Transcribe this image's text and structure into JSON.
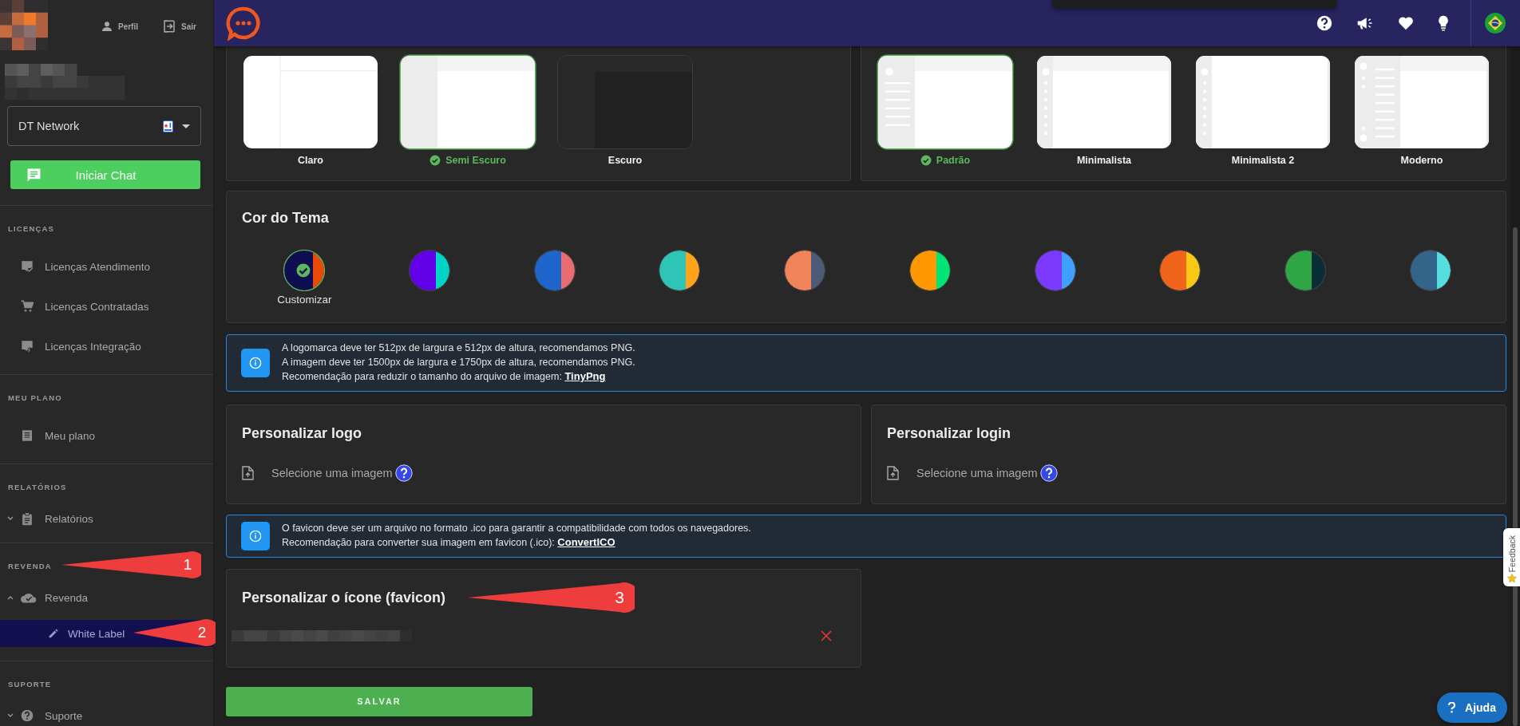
{
  "sidebar": {
    "profile_links": [
      {
        "label": "Perfil"
      },
      {
        "label": "Sair"
      }
    ],
    "workspace": "DT Network",
    "start_chat": "Iniciar Chat",
    "sections": [
      {
        "title": "LICENÇAS",
        "items": [
          {
            "label": "Licenças Atendimento",
            "selected": false
          },
          {
            "label": "Licenças Contratadas",
            "selected": false
          },
          {
            "label": "Licenças Integração",
            "selected": false
          }
        ]
      },
      {
        "title": "MEU PLANO",
        "items": [
          {
            "label": "Meu plano",
            "selected": false
          }
        ]
      },
      {
        "title": "RELATÓRIOS",
        "items": [
          {
            "label": "Relatórios",
            "selected": false,
            "expanded": false
          }
        ]
      },
      {
        "title": "REVENDA",
        "items": [
          {
            "label": "Revenda",
            "selected": false,
            "expanded": true,
            "children": [
              {
                "label": "White Label",
                "selected": true
              }
            ]
          }
        ]
      },
      {
        "title": "SUPORTE",
        "items": [
          {
            "label": "Suporte",
            "selected": false,
            "expanded": false
          }
        ]
      }
    ]
  },
  "theme_modes": {
    "options": [
      {
        "label": "Claro",
        "kind": "light",
        "selected": false
      },
      {
        "label": "Semi Escuro",
        "kind": "semi",
        "selected": true
      },
      {
        "label": "Escuro",
        "kind": "dark",
        "selected": false
      }
    ]
  },
  "layouts": {
    "options": [
      {
        "label": "Padrão",
        "kind": "default",
        "selected": true
      },
      {
        "label": "Minimalista",
        "kind": "minimal",
        "selected": false
      },
      {
        "label": "Minimalista 2",
        "kind": "minimal2",
        "selected": false
      },
      {
        "label": "Moderno",
        "kind": "modern",
        "selected": false
      }
    ]
  },
  "theme_color": {
    "title": "Cor do Tema",
    "swatches": [
      {
        "label": "Customizar",
        "halves": [
          {
            "color": "#0e0e50"
          },
          {
            "color": "#e84a0a"
          }
        ],
        "selected": true
      },
      {
        "halves": [
          {
            "color": "#6200ea"
          },
          {
            "color": "#00d4c4"
          }
        ],
        "selected": false
      },
      {
        "halves": [
          {
            "color": "#1e66cc"
          },
          {
            "color": "#e86c70"
          }
        ],
        "selected": false
      },
      {
        "halves": [
          {
            "color": "#2ec4b6"
          },
          {
            "color": "#ffa31a"
          }
        ],
        "selected": false
      },
      {
        "halves": [
          {
            "color": "#f08458"
          },
          {
            "color": "#4c5c78"
          }
        ],
        "selected": false
      },
      {
        "halves": [
          {
            "color": "#ff9800"
          },
          {
            "color": "#00e676"
          }
        ],
        "selected": false
      },
      {
        "halves": [
          {
            "color": "#7c3aff"
          },
          {
            "color": "#3fa0ff"
          }
        ],
        "selected": false
      },
      {
        "halves": [
          {
            "color": "#f0641c"
          },
          {
            "color": "#f8c814"
          }
        ],
        "selected": false
      },
      {
        "halves": [
          {
            "color": "#2ea646"
          },
          {
            "color": "#0a2e36"
          }
        ],
        "selected": false
      },
      {
        "halves": [
          {
            "color": "#33658a"
          },
          {
            "color": "#55dde0"
          }
        ],
        "selected": false
      }
    ]
  },
  "logo_info": {
    "lines": [
      "A logomarca deve ter 512px de largura e 512px de altura, recomendamos PNG.",
      "A imagem deve ter 1500px de largura e 1750px de altura, recomendamos PNG."
    ],
    "link_line": "Recomendação para reduzir o tamanho do arquivo de imagem:",
    "link": "TinyPng"
  },
  "uploads": [
    {
      "title": "Personalizar logo",
      "prompt": "Selecione uma imagem"
    },
    {
      "title": "Personalizar login",
      "prompt": "Selecione uma imagem"
    }
  ],
  "favicon_info": {
    "lines": [
      "O favicon deve ser um arquivo no formato .ico para garantir a compatibilidade com todos os navegadores."
    ],
    "link_line": "Recomendação para converter sua imagem em favicon (.ico):",
    "link": "ConvertICO"
  },
  "favicon": {
    "title": "Personalizar o ícone (favicon)"
  },
  "save_button": "SALVAR",
  "help_button": "Ajuda",
  "feedback_tab": "Feedback",
  "annotations": [
    {
      "number": "1"
    },
    {
      "number": "2"
    },
    {
      "number": "3"
    }
  ]
}
